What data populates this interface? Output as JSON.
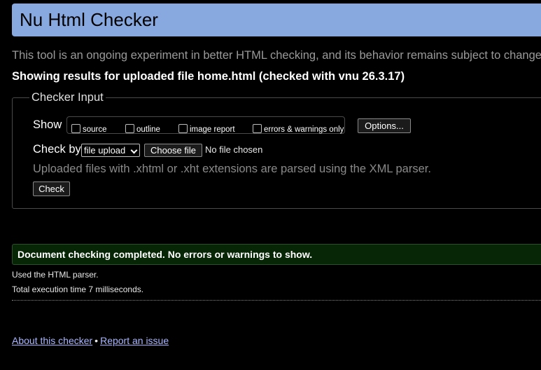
{
  "header": {
    "title": "Nu Html Checker"
  },
  "intro_text": "This tool is an ongoing experiment in better HTML checking, and its behavior remains subject to change",
  "results_heading": "Showing results for uploaded file home.html (checked with vnu 26.3.17)",
  "checker_input": {
    "legend": "Checker Input",
    "show_label": "Show",
    "show_options": [
      {
        "label": "source",
        "checked": false
      },
      {
        "label": "outline",
        "checked": false
      },
      {
        "label": "image report",
        "checked": false
      },
      {
        "label": "errors & warnings only",
        "checked": false
      }
    ],
    "options_button": "Options...",
    "check_by_label": "Check by",
    "check_by_selected": "file upload",
    "choose_file_button": "Choose file",
    "no_file_text": "No file chosen",
    "upload_note": "Uploaded files with .xhtml or .xht extensions are parsed using the XML parser.",
    "check_button": "Check"
  },
  "result": {
    "success_message": "Document checking completed. No errors or warnings to show.",
    "parser_used": "Used the HTML parser.",
    "execution_time": "Total execution time 7 milliseconds."
  },
  "footer": {
    "about_link": "About this checker",
    "separator": "•",
    "report_link": "Report an issue"
  },
  "colors": {
    "title_bar": "#88a9e0",
    "success_bg": "#062606",
    "link": "#a9b6ff"
  }
}
